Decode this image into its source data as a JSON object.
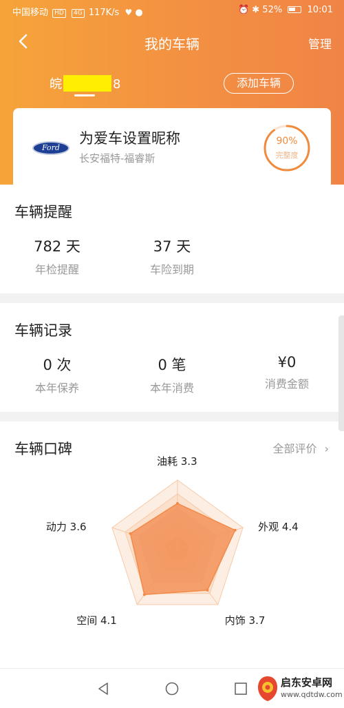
{
  "status_bar": {
    "carrier": "中国移动",
    "hd": "HD",
    "signal": "4G",
    "speed": "117K/s",
    "battery": "52%",
    "time": "10:01"
  },
  "nav": {
    "back_icon": "chevron-left-icon",
    "title": "我的车辆",
    "manage": "管理"
  },
  "vehicle_tab": {
    "plate_prefix": "皖",
    "plate_suffix": "8",
    "add_button": "添加车辆"
  },
  "car_card": {
    "brand_logo_text": "Ford",
    "nickname_prompt": "为爱车设置昵称",
    "model": "长安福特-福睿斯",
    "completeness_value": "90%",
    "completeness_fraction": 0.9,
    "completeness_label": "完整度"
  },
  "reminders": {
    "title": "车辆提醒",
    "items": [
      {
        "value": "782 天",
        "label": "年检提醒"
      },
      {
        "value": "37 天",
        "label": "车险到期"
      }
    ]
  },
  "records": {
    "title": "车辆记录",
    "items": [
      {
        "value": "0 次",
        "label": "本年保养"
      },
      {
        "value": "0 笔",
        "label": "本年消费"
      },
      {
        "value": "¥0",
        "label": "消费金额"
      }
    ]
  },
  "reputation": {
    "title": "车辆口碑",
    "all_reviews": "全部评价",
    "chart_data": {
      "type": "radar",
      "max": 5,
      "axes": [
        {
          "name": "油耗",
          "value": 3.3,
          "label": "油耗 3.3"
        },
        {
          "name": "外观",
          "value": 4.4,
          "label": "外观 4.4"
        },
        {
          "name": "内饰",
          "value": 3.7,
          "label": "内饰 3.7"
        },
        {
          "name": "空间",
          "value": 4.1,
          "label": "空间 4.1"
        },
        {
          "name": "动力",
          "value": 3.6,
          "label": "动力 3.6"
        }
      ]
    }
  },
  "watermark": {
    "text": "启东安卓网",
    "url": "www.qdtdw.com"
  },
  "colors": {
    "accent": "#f08a3c",
    "radar_fill": "#f3935a"
  }
}
